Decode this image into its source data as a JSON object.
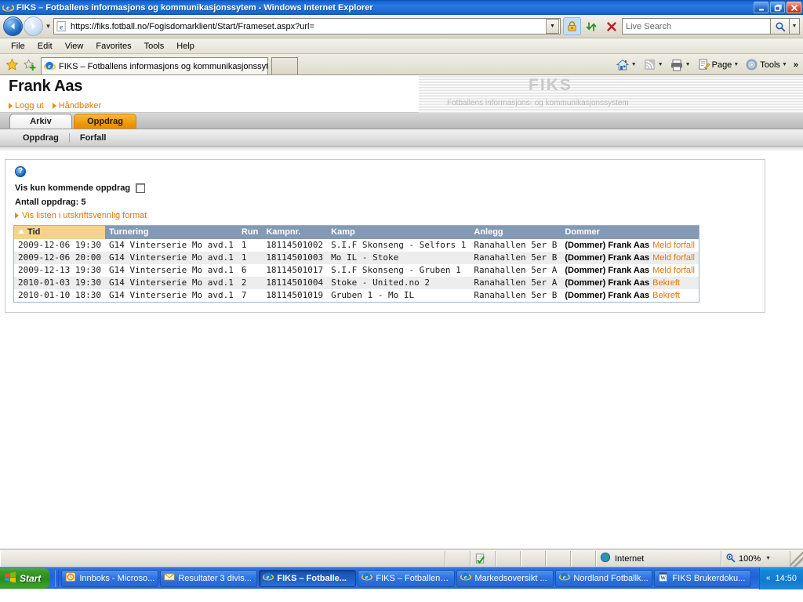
{
  "window": {
    "title": "FIKS – Fotballens informasjons og kommunikasjonssytem - Windows Internet Explorer",
    "minimize_label": "_",
    "restore_label": "❐",
    "close_label": "✕"
  },
  "address_bar": {
    "url": "https://fiks.fotball.no/Fogisdomarklient/Start/Frameset.aspx?url=",
    "search_placeholder": "Live Search"
  },
  "menu": {
    "items": [
      "File",
      "Edit",
      "View",
      "Favorites",
      "Tools",
      "Help"
    ]
  },
  "browser_tabs": {
    "tabs": [
      {
        "label": "FIKS – Fotballens informasjons og kommunikasjonssytem"
      }
    ],
    "page_label": "Page",
    "tools_label": "Tools",
    "overflow_label": "»"
  },
  "page": {
    "user_name": "Frank Aas",
    "links": [
      {
        "label": "Logg ut"
      },
      {
        "label": "Håndbøker"
      }
    ],
    "logo": "FIKS",
    "logo_subtitle": "Fotballens informasjons- og kommunikasjonssystem",
    "main_tabs": [
      {
        "label": "Arkiv",
        "active": false
      },
      {
        "label": "Oppdrag",
        "active": true
      }
    ],
    "sub_nav": [
      {
        "label": "Oppdrag"
      },
      {
        "label": "Forfall"
      }
    ],
    "help_icon": "question-mark",
    "filter_label": "Vis kun kommende oppdrag",
    "filter_checked": false,
    "count_label": "Antall oppdrag: 5",
    "print_link": "Vis listen i utskriftsvennlig format",
    "table": {
      "sort_column": "Tid",
      "sort_direction": "ascending",
      "columns": [
        "Tid",
        "Turnering",
        "Run",
        "Kampnr.",
        "Kamp",
        "Anlegg",
        "Dommer"
      ],
      "rows": [
        {
          "tid": "2009-12-06 19:30",
          "turnering": "G14 Vinterserie Mo avd.1",
          "run": "1",
          "kampnr": "18114501002",
          "kamp": "S.I.F Skonseng - Selfors 1",
          "anlegg": "Ranahallen 5er B",
          "dommer": "(Dommer) Frank Aas",
          "action": "Meld forfall"
        },
        {
          "tid": "2009-12-06 20:00",
          "turnering": "G14 Vinterserie Mo avd.1",
          "run": "1",
          "kampnr": "18114501003",
          "kamp": "Mo IL  - Stoke",
          "anlegg": "Ranahallen 5er B",
          "dommer": "(Dommer) Frank Aas",
          "action": "Meld forfall"
        },
        {
          "tid": "2009-12-13 19:30",
          "turnering": "G14 Vinterserie Mo avd.1",
          "run": "6",
          "kampnr": "18114501017",
          "kamp": "S.I.F Skonseng - Gruben 1",
          "anlegg": "Ranahallen 5er A",
          "dommer": "(Dommer) Frank Aas",
          "action": "Meld forfall"
        },
        {
          "tid": "2010-01-03 19:30",
          "turnering": "G14 Vinterserie Mo avd.1",
          "run": "2",
          "kampnr": "18114501004",
          "kamp": "Stoke - United.no 2",
          "anlegg": "Ranahallen 5er A",
          "dommer": "(Dommer) Frank Aas",
          "action": "Bekreft"
        },
        {
          "tid": "2010-01-10 18:30",
          "turnering": "G14 Vinterserie Mo avd.1",
          "run": "7",
          "kampnr": "18114501019",
          "kamp": "Gruben 1 - Mo IL",
          "anlegg": "Ranahallen 5er B",
          "dommer": "(Dommer) Frank Aas",
          "action": "Bekreft"
        }
      ]
    }
  },
  "status_bar": {
    "zone": "Internet",
    "zoom": "100%"
  },
  "taskbar": {
    "start_label": "Start",
    "items": [
      {
        "label": "Innboks - Microso...",
        "icon": "outlook-icon",
        "active": false
      },
      {
        "label": "Resultater 3 divis...",
        "icon": "mail-icon",
        "active": false
      },
      {
        "label": "FIKS – Fotballe...",
        "icon": "ie-icon",
        "active": true
      },
      {
        "label": "FIKS – Fotballens...",
        "icon": "ie-icon",
        "active": false
      },
      {
        "label": "Markedsoversikt ...",
        "icon": "ie-icon",
        "active": false
      },
      {
        "label": "Nordland Fotballk...",
        "icon": "ie-icon",
        "active": false
      },
      {
        "label": "FIKS Brukerdoku...",
        "icon": "word-icon",
        "active": false
      }
    ],
    "tray_chevron": "«",
    "clock": "14:50"
  },
  "colors": {
    "accent_orange": "#E2760C",
    "tab_active": "#EE9407",
    "table_header": "#8399B4",
    "sorted_header": "#F3D38D"
  }
}
